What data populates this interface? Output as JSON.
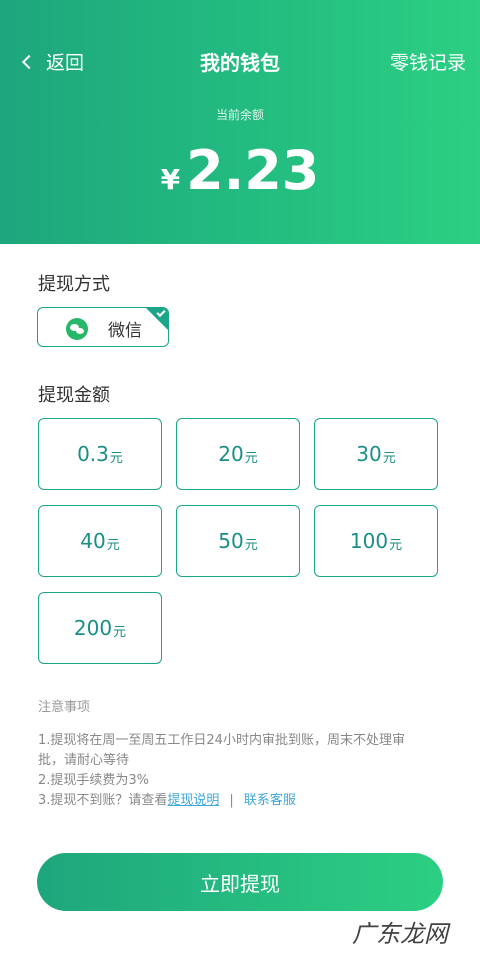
{
  "nav": {
    "back_label": "返回",
    "title": "我的钱包",
    "records_label": "零钱记录"
  },
  "balance": {
    "label": "当前余额",
    "currency": "¥",
    "amount": "2.23"
  },
  "method": {
    "title": "提现方式",
    "wechat_label": "微信",
    "selected": true
  },
  "amount_section": {
    "title": "提现金额",
    "options": [
      {
        "value": "0.3",
        "unit": "元"
      },
      {
        "value": "20",
        "unit": "元"
      },
      {
        "value": "30",
        "unit": "元"
      },
      {
        "value": "40",
        "unit": "元"
      },
      {
        "value": "50",
        "unit": "元"
      },
      {
        "value": "100",
        "unit": "元"
      },
      {
        "value": "200",
        "unit": "元"
      }
    ]
  },
  "notes": {
    "title": "注意事项",
    "line1a": "1.提现将在周一至周五工作日24小时内审批到账，周末不处理审",
    "line1b": "批，请耐心等待",
    "line2": "2.提现手续费为3%",
    "line3_prefix": "3.提现不到账？请查看",
    "link_explain": "提现说明",
    "separator": "|",
    "link_service": "联系客服"
  },
  "submit_label": "立即提现",
  "watermark": "广东龙网",
  "colors": {
    "accent": "#1ba68a",
    "header_start": "#1ea67c",
    "header_end": "#2ccf83",
    "link": "#3fa7d9"
  }
}
